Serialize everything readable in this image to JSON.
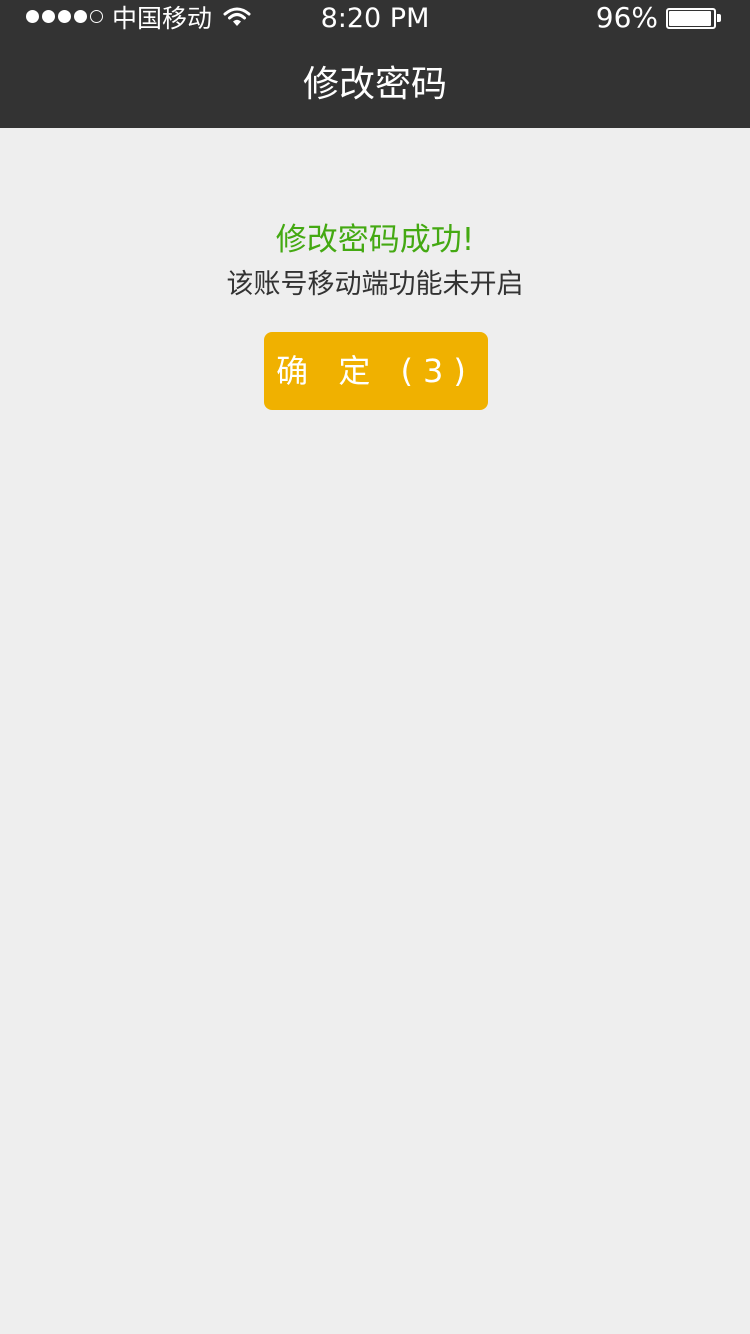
{
  "status_bar": {
    "signal_filled": 4,
    "signal_total": 5,
    "carrier": "中国移动",
    "time": "8:20 PM",
    "battery_percent_text": "96%",
    "battery_level": 0.96,
    "icons": [
      "signal-dots-icon",
      "wifi-icon",
      "battery-icon"
    ]
  },
  "nav": {
    "title": "修改密码"
  },
  "message": {
    "success": "修改密码成功!",
    "detail": "该账号移动端功能未开启"
  },
  "confirm_button": {
    "label": "确 定 (3)",
    "color": "#f0b100"
  },
  "colors": {
    "header_bg": "#333333",
    "page_bg": "#eeeeee",
    "success_text": "#44a912"
  }
}
